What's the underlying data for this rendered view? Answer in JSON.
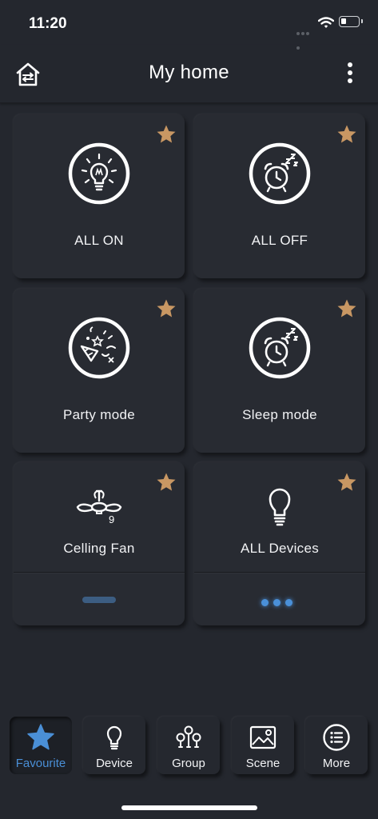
{
  "status_bar": {
    "time": "11:20"
  },
  "header": {
    "title": "My home"
  },
  "cards": [
    {
      "label": "ALL ON",
      "icon": "lightbulb-icon",
      "favourite": true
    },
    {
      "label": "ALL OFF",
      "icon": "alarm-clock-icon",
      "favourite": true
    },
    {
      "label": "Party mode",
      "icon": "party-popper-icon",
      "favourite": true
    },
    {
      "label": "Sleep mode",
      "icon": "alarm-clock-icon",
      "favourite": true
    },
    {
      "label": "Celling Fan",
      "icon": "ceiling-fan-icon",
      "badge": "9",
      "favourite": true
    },
    {
      "label": "ALL Devices",
      "icon": "lightbulb-outline-icon",
      "favourite": true
    }
  ],
  "bottom_nav": [
    {
      "label": "Favourite",
      "icon": "star-icon",
      "active": true
    },
    {
      "label": "Device",
      "icon": "lightbulb-icon"
    },
    {
      "label": "Group",
      "icon": "bulb-group-icon"
    },
    {
      "label": "Scene",
      "icon": "image-icon"
    },
    {
      "label": "More",
      "icon": "list-circle-icon"
    }
  ],
  "colors": {
    "background": "#24272e",
    "card": "#282b32",
    "star": "#c89763",
    "accent": "#4a8fd6"
  }
}
